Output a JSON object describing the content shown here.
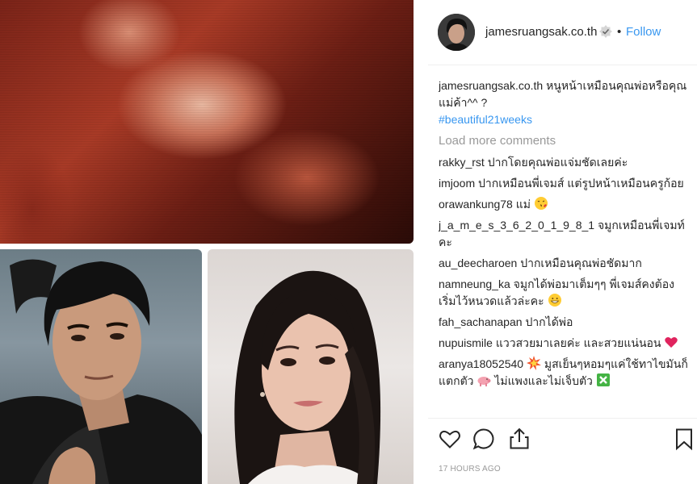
{
  "header": {
    "username": "jamesruangsak.co.th",
    "separator": "•",
    "follow_label": "Follow"
  },
  "caption": {
    "username": "jamesruangsak.co.th",
    "text": "หนูหน้าเหมือนคุณพ่อหรือคุณแม่ค้า^^ ?",
    "hashtag": "#beautiful21weeks"
  },
  "load_more_label": "Load more comments",
  "comments": [
    {
      "username": "rakky_rst",
      "text": "ปากโดยคุณพ่อแจ่มชัดเลยค่ะ"
    },
    {
      "username": "imjoom",
      "text": "ปากเหมือนพี่เจมส์ แต่รูปหน้าเหมือนครูก้อย"
    },
    {
      "username": "orawankung78",
      "text": "แม่"
    },
    {
      "username": "j_a_m_e_s_3_6_2_0_1_9_8_1",
      "text": "จมูกเหมือนพี่เจมท์คะ"
    },
    {
      "username": "au_deecharoen",
      "text": "ปากเหมือนคุณพ่อชัดมาก"
    },
    {
      "username": "namneung_ka",
      "text": "จมูกได้พ่อมาเต็มๆๆ พี่เจมส์คงต้องเริ่มไว้หนวดแล้วล่ะคะ"
    },
    {
      "username": "fah_sachanapan",
      "text": "ปากได้พ่อ"
    },
    {
      "username": "nupuismile",
      "text": "แววสวยมาเลยค่ะ และสวยแน่นอน"
    },
    {
      "username": "aranya18052540",
      "text_a": "มูสเย็นๆหอมๆแค่ใช้ทาไขมันก็แตกตัว",
      "text_b": "ไม่แพงและไม่เจ็บตัว"
    }
  ],
  "icons": {
    "verified": "verified-badge-icon",
    "like": "heart-icon",
    "comment": "speech-bubble-icon",
    "share": "share-icon",
    "save": "bookmark-icon",
    "emoji_kiss": "face-blowing-kiss-emoji",
    "emoji_grin": "grinning-face-emoji",
    "emoji_heart": "red-heart-emoji",
    "emoji_collision": "collision-emoji",
    "emoji_pig": "pig-emoji",
    "emoji_check": "cross-mark-button-emoji"
  },
  "timestamp": "17 HOURS AGO",
  "colors": {
    "link_blue": "#3897f0",
    "muted": "#999999",
    "text": "#262626"
  }
}
